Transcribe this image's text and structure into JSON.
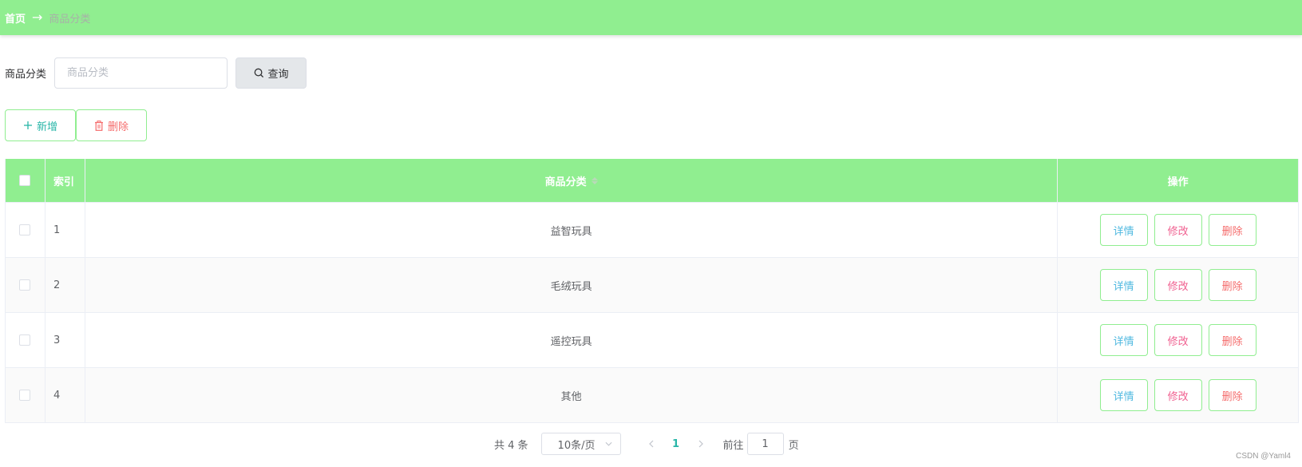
{
  "breadcrumb": {
    "home": "首页",
    "separator": "→",
    "current": "商品分类"
  },
  "search": {
    "label": "商品分类",
    "placeholder": "商品分类",
    "value": "",
    "button_label": "查询"
  },
  "toolbar": {
    "add_label": "新增",
    "delete_label": "删除"
  },
  "table": {
    "columns": {
      "index": "索引",
      "name": "商品分类",
      "ops": "操作"
    },
    "rows": [
      {
        "index": "1",
        "name": "益智玩具"
      },
      {
        "index": "2",
        "name": "毛绒玩具"
      },
      {
        "index": "3",
        "name": "遥控玩具"
      },
      {
        "index": "4",
        "name": "其他"
      }
    ],
    "op_labels": {
      "detail": "详情",
      "edit": "修改",
      "delete": "删除"
    }
  },
  "pagination": {
    "total_text": "共 4 条",
    "page_size": "10条/页",
    "current_page": "1",
    "goto_label": "前往",
    "goto_value": "1",
    "goto_suffix": "页"
  },
  "watermark": "CSDN @Yaml4",
  "colors": {
    "header_green": "#90ee90",
    "teal": "#29b6a8",
    "danger": "#f56c6c",
    "detail": "#4fb9e0",
    "edit": "#f06090"
  }
}
